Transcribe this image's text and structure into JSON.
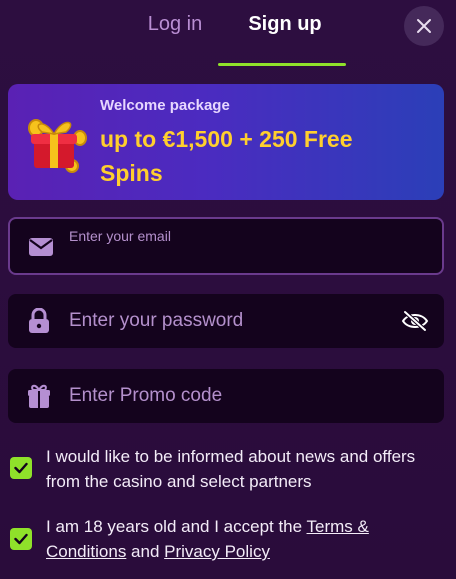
{
  "tabs": {
    "login_label": "Log in",
    "signup_label": "Sign up",
    "active": "signup"
  },
  "close": {
    "icon": "close-icon"
  },
  "banner": {
    "kicker": "Welcome package",
    "headline": "up to €1,500 + 250 Free Spins",
    "icon": "gift-icon"
  },
  "form": {
    "email": {
      "placeholder": "Enter your email",
      "value": "",
      "icon": "envelope-icon"
    },
    "password": {
      "placeholder": "Enter your password",
      "value": "",
      "icon": "lock-icon",
      "toggle_icon": "eye-off-icon"
    },
    "promo": {
      "placeholder": "Enter Promo code",
      "value": "",
      "icon": "gift-icon"
    }
  },
  "consents": {
    "marketing": {
      "checked": true,
      "text": "I would like to be informed about news and offers from the casino and select partners"
    },
    "age": {
      "checked": true,
      "text_prefix": "I am 18 years old and I accept the ",
      "terms_link": "Terms & Conditions",
      "text_middle": " and ",
      "privacy_link": "Privacy Policy"
    }
  },
  "colors": {
    "background": "#2a0d3a",
    "accent_green": "#8fe12a",
    "headline_yellow": "#ffcf2e",
    "placeholder": "#b490cc",
    "field_bg": "#14031d"
  }
}
